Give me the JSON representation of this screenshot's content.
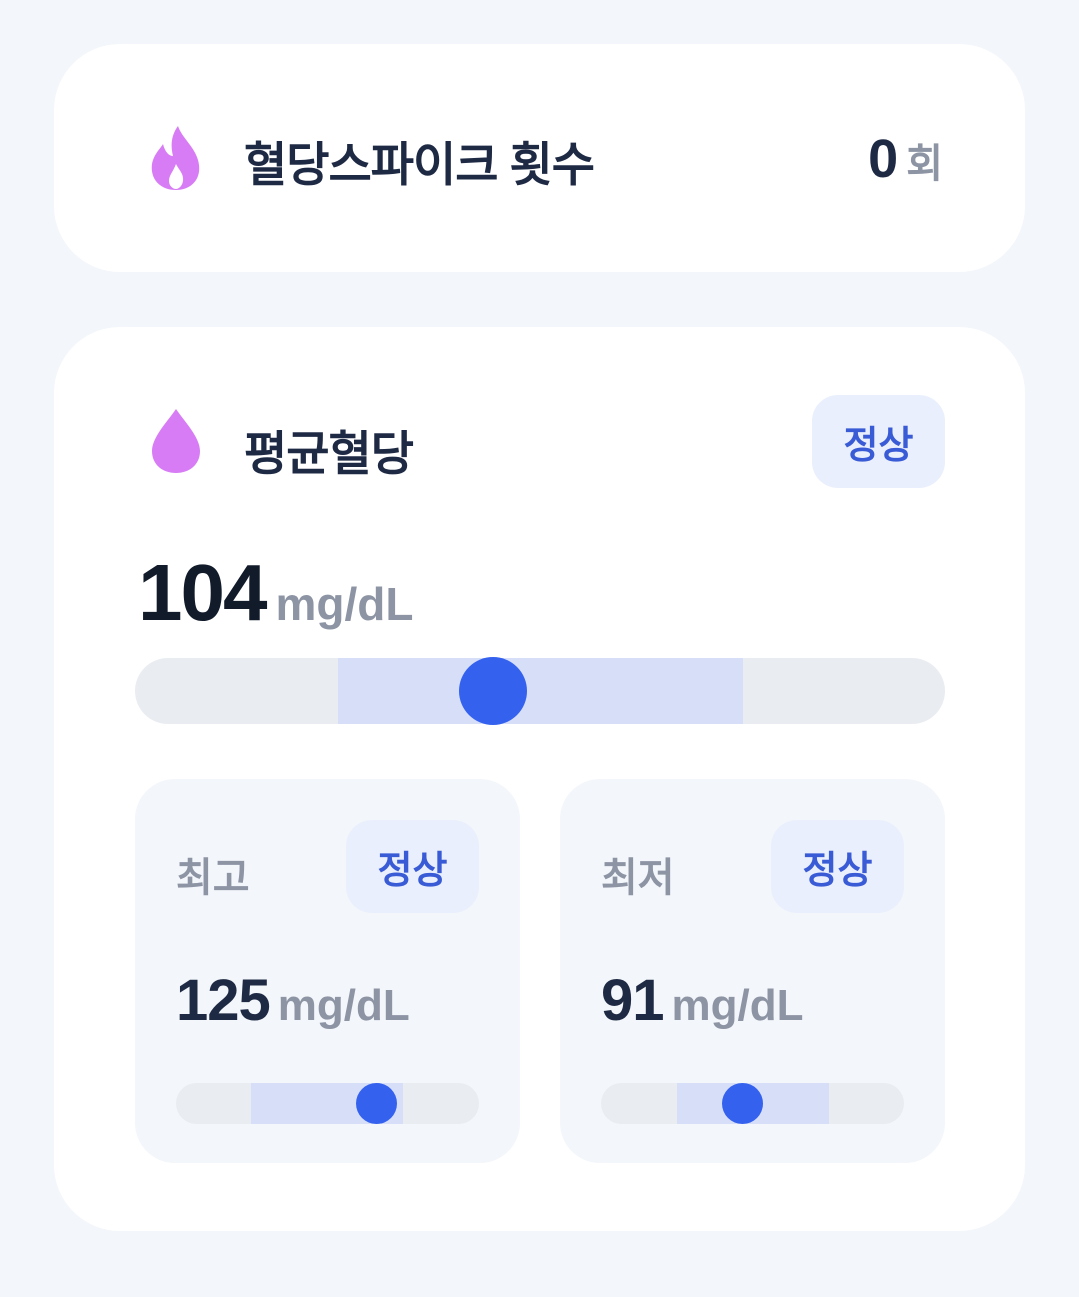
{
  "spike": {
    "title": "혈당스파이크 횟수",
    "count": "0",
    "count_unit": "회",
    "icon": "flame-icon"
  },
  "average": {
    "title": "평균혈당",
    "icon": "blood-drop-icon",
    "status": "정상",
    "value": "104",
    "unit": "mg/dL"
  },
  "max": {
    "label": "최고",
    "status": "정상",
    "value": "125",
    "unit": "mg/dL"
  },
  "min": {
    "label": "최저",
    "status": "정상",
    "value": "91",
    "unit": "mg/dL"
  },
  "colors": {
    "accent": "#3461ee",
    "icon": "#d77cf5",
    "range": "#d7dff8"
  }
}
